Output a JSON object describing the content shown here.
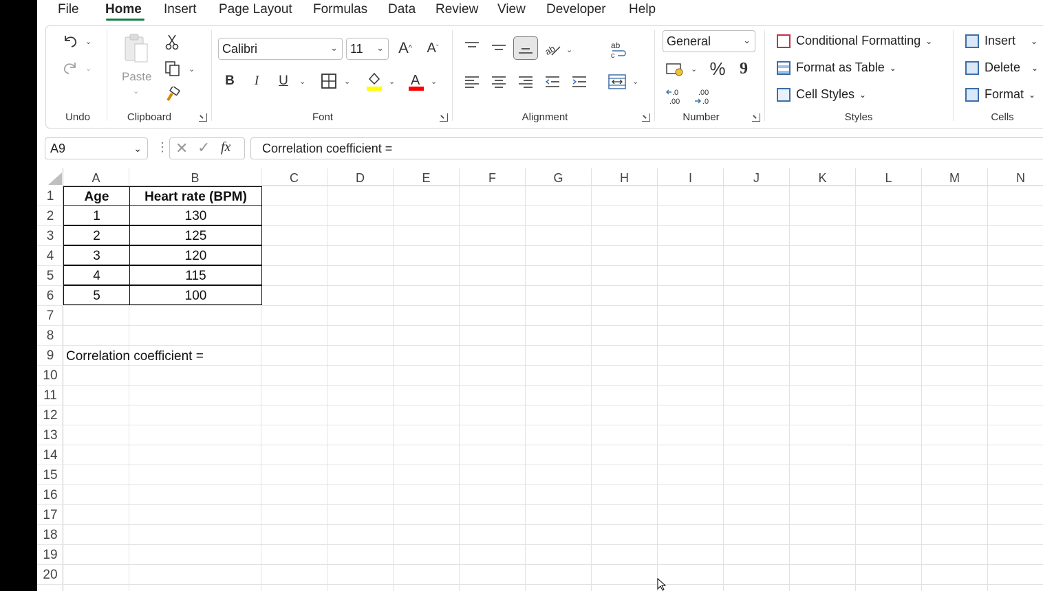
{
  "menu": {
    "tabs": [
      "File",
      "Home",
      "Insert",
      "Page Layout",
      "Formulas",
      "Data",
      "Review",
      "View",
      "Developer",
      "Help"
    ],
    "active": "Home"
  },
  "ribbon": {
    "undo_group": "Undo",
    "clipboard_group": "Clipboard",
    "paste_label": "Paste",
    "font_group": "Font",
    "font_name": "Calibri",
    "font_size": "11",
    "bold": "B",
    "italic": "I",
    "underline": "U",
    "alignment_group": "Alignment",
    "number_group": "Number",
    "number_format": "General",
    "percent": "%",
    "comma": "9",
    "styles_group": "Styles",
    "conditional_formatting": "Conditional Formatting",
    "format_as_table": "Format as Table",
    "cell_styles": "Cell Styles",
    "cells_group": "Cells",
    "insert": "Insert",
    "delete": "Delete",
    "format": "Format",
    "fill_color": "#ffff00",
    "font_color": "#ff0000"
  },
  "formula_bar": {
    "name_box": "A9",
    "fx": "fx",
    "content": "Correlation coefficient ="
  },
  "sheet": {
    "columns": [
      "A",
      "B",
      "C",
      "D",
      "E",
      "F",
      "G",
      "H",
      "I",
      "J",
      "K",
      "L",
      "M",
      "N"
    ],
    "rows": [
      "1",
      "2",
      "3",
      "4",
      "5",
      "6",
      "7",
      "8",
      "9",
      "10",
      "11",
      "12",
      "13",
      "14",
      "15",
      "16",
      "17",
      "18",
      "19",
      "20"
    ],
    "table_header": [
      "Age",
      "Heart rate (BPM)"
    ],
    "table_rows": [
      [
        "1",
        "130"
      ],
      [
        "2",
        "125"
      ],
      [
        "3",
        "120"
      ],
      [
        "4",
        "115"
      ],
      [
        "5",
        "100"
      ]
    ],
    "a9": "Correlation coefficient ="
  }
}
